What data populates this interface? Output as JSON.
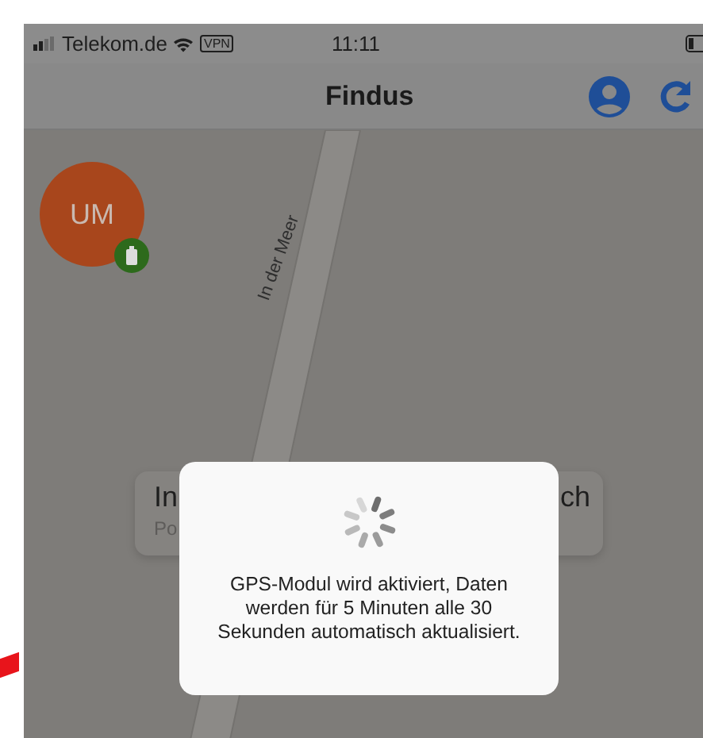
{
  "status_bar": {
    "carrier": "Telekom.de",
    "vpn": "VPN",
    "time": "11:11"
  },
  "nav_bar": {
    "title": "Findus"
  },
  "map": {
    "street": "In der Meer",
    "marker": {
      "initials": "UM",
      "color": "#a8461c"
    },
    "card": {
      "title_start": "In",
      "title_end": "ch",
      "subtitle": "Po"
    }
  },
  "dialog": {
    "message": "GPS-Modul wird aktiviert, Daten werden für 5 Minuten alle 30 Sekunden automatisch aktualisiert."
  }
}
